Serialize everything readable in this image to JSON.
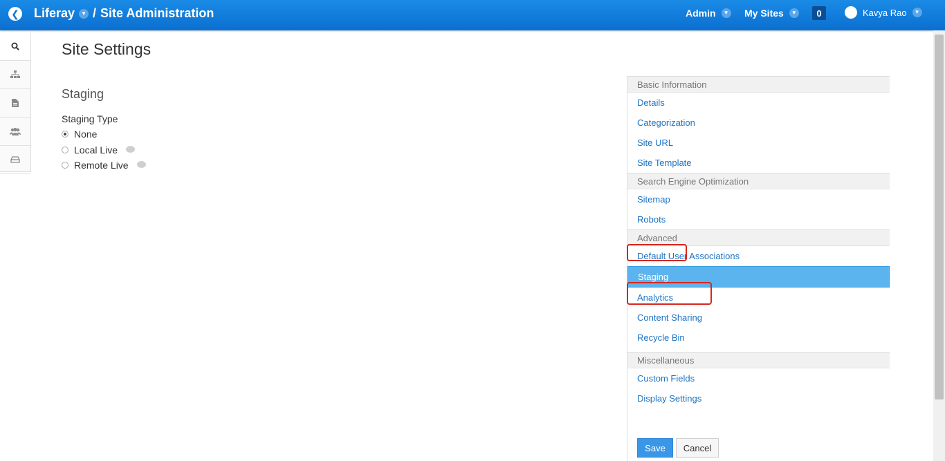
{
  "topbar": {
    "brand": "Liferay",
    "separator": "/",
    "section": "Site Administration",
    "admin_label": "Admin",
    "my_sites_label": "My Sites",
    "notification_count": "0",
    "user_name": "Kavya Rao"
  },
  "dock": {
    "items": [
      {
        "icon": "search-icon"
      },
      {
        "icon": "sitemap-icon"
      },
      {
        "icon": "document-icon"
      },
      {
        "icon": "users-icon"
      },
      {
        "icon": "inbox-icon"
      }
    ]
  },
  "main": {
    "page_title": "Site Settings",
    "section_title": "Staging",
    "field_label": "Staging Type",
    "options": [
      {
        "label": "None",
        "checked": true
      },
      {
        "label": "Local Live",
        "checked": false
      },
      {
        "label": "Remote Live",
        "checked": false
      }
    ]
  },
  "menu": {
    "basic_header": "Basic Information",
    "basic_items": [
      "Details",
      "Categorization",
      "Site URL",
      "Site Template"
    ],
    "seo_header": "Search Engine Optimization",
    "seo_items": [
      "Sitemap",
      "Robots"
    ],
    "advanced_header": "Advanced",
    "advanced_items": [
      "Default User Associations",
      "Staging",
      "Analytics",
      "Content Sharing",
      "Recycle Bin"
    ],
    "misc_header": "Miscellaneous",
    "misc_items": [
      "Custom Fields",
      "Display Settings"
    ]
  },
  "actions": {
    "save_label": "Save",
    "cancel_label": "Cancel"
  },
  "colors": {
    "topbar": "#0f76d6",
    "link": "#1b73c4",
    "selected": "#5cb4ee",
    "highlight": "#d7261e"
  }
}
